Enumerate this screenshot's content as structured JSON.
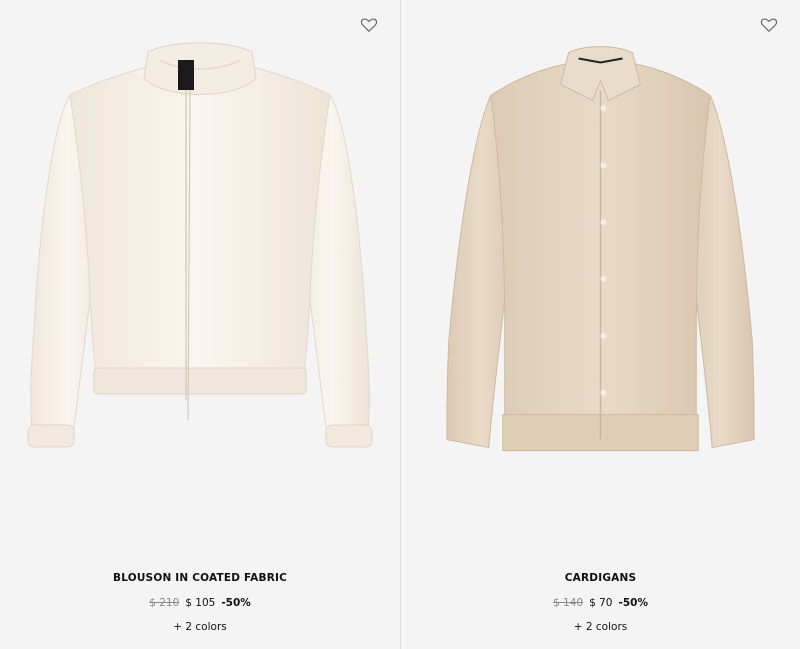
{
  "products": [
    {
      "name": "BLOUSON IN COATED FABRIC",
      "price_original": "$ 210",
      "price_sale": "$ 105",
      "discount": "-50%",
      "colors": "+ 2 colors",
      "wishlist_icon": "heart-outline-icon",
      "garment_color": "#f6f0e6"
    },
    {
      "name": "CARDIGANS",
      "price_original": "$ 140",
      "price_sale": "$ 70",
      "discount": "-50%",
      "colors": "+ 2 colors",
      "wishlist_icon": "heart-outline-icon",
      "garment_color": "#e6d6c3"
    }
  ]
}
